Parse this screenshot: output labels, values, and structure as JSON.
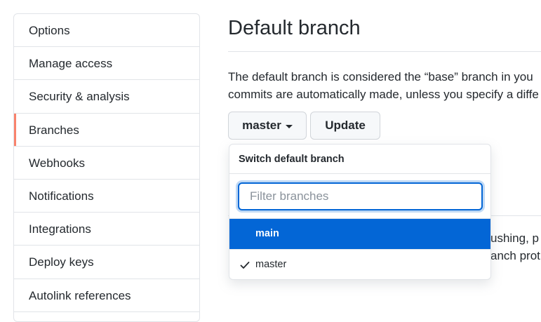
{
  "sidebar": {
    "items": [
      {
        "label": "Options"
      },
      {
        "label": "Manage access"
      },
      {
        "label": "Security & analysis"
      },
      {
        "label": "Branches"
      },
      {
        "label": "Webhooks"
      },
      {
        "label": "Notifications"
      },
      {
        "label": "Integrations"
      },
      {
        "label": "Deploy keys"
      },
      {
        "label": "Autolink references"
      }
    ],
    "selected": "Branches",
    "accent_color": "#f9826c"
  },
  "main": {
    "title": "Default branch",
    "description_lines": [
      "The default branch is considered the “base” branch in you",
      "commits are automatically made, unless you specify a diffe"
    ],
    "branch_button_label": "master",
    "update_button_label": "Update",
    "behind_text_lines": [
      "ushing, p",
      "anch prot"
    ]
  },
  "menu": {
    "header": "Switch default branch",
    "filter_placeholder": "Filter branches",
    "filter_value": "",
    "items": [
      {
        "label": "main",
        "active": true,
        "checked": false
      },
      {
        "label": "master",
        "active": false,
        "checked": true
      }
    ],
    "active_color": "#0366d6",
    "check_icon": "check-icon"
  }
}
